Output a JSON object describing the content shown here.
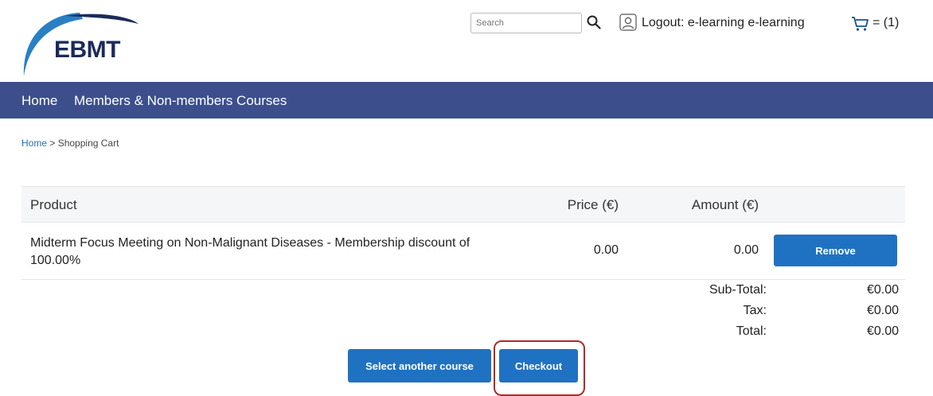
{
  "header": {
    "logo_text": "EBMT",
    "search_placeholder": "Search",
    "logout_label": "Logout: e-learning e-learning",
    "cart_count_label": "= (1)"
  },
  "nav": {
    "items": [
      {
        "label": "Home"
      },
      {
        "label": "Members & Non-members Courses"
      }
    ]
  },
  "breadcrumb": {
    "home": "Home",
    "separator": " > ",
    "current": "Shopping Cart"
  },
  "cart_table": {
    "headers": {
      "product": "Product",
      "price": "Price (€)",
      "amount": "Amount (€)"
    },
    "rows": [
      {
        "product": "Midterm Focus Meeting on Non-Malignant Diseases - Membership discount of 100.00%",
        "price": "0.00",
        "amount": "0.00",
        "remove_label": "Remove"
      }
    ]
  },
  "totals": {
    "subtotal_label": "Sub-Total:",
    "subtotal_value": "€0.00",
    "tax_label": "Tax:",
    "tax_value": "€0.00",
    "total_label": "Total:",
    "total_value": "€0.00"
  },
  "actions": {
    "select_another_label": "Select another course",
    "checkout_label": "Checkout"
  },
  "colors": {
    "navbar": "#3c4f8c",
    "button": "#1f72c2",
    "highlight": "#b22a2a",
    "logo_arc": "#2a7fc4"
  },
  "icons": [
    "search-icon",
    "user-icon",
    "cart-icon"
  ]
}
